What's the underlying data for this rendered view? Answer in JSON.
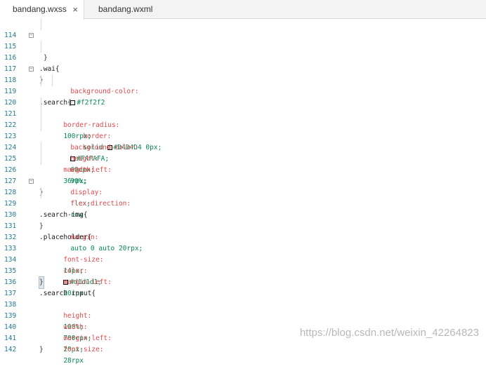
{
  "tabs": [
    {
      "label": "bandang.wxss",
      "active": true,
      "close_icon": "×"
    },
    {
      "label": "bandang.wxml",
      "active": false
    }
  ],
  "watermark": "https://blog.csdn.net/weixin_42264823",
  "colors": {
    "selector": "#1a1a1a",
    "property": "#e0494d",
    "value": "#098658",
    "line_number": "#237893"
  },
  "lines": [
    {
      "n": "114",
      "text": "}"
    },
    {
      "n": "115",
      "text": ".wai{"
    },
    {
      "n": "116",
      "prop": "background-color:",
      "val": "#f2f2f2",
      "swatch": "#f2f2f2"
    },
    {
      "n": "117",
      "text": "}"
    },
    {
      "n": "118",
      "text": ".search{"
    },
    {
      "n": "119",
      "prop": "border:",
      "val": "solid ",
      "swatch": "#D4D4D4",
      "val2": "#D4D4D4 0px;"
    },
    {
      "n": "120",
      "prop": "border-radius:",
      "val": "100rpx;"
    },
    {
      "n": "121",
      "prop": "background-color:",
      "swatch": "#FAFAFA",
      "val": "#FAFAFA;"
    },
    {
      "n": "122",
      "prop": "height:",
      "val": "60rpx;"
    },
    {
      "n": "123",
      "prop": "width:",
      "val": "90%;"
    },
    {
      "n": "124",
      "prop": "margin-left:",
      "val": "36rpx;"
    },
    {
      "n": "125",
      "prop": "display:",
      "val": "flex;"
    },
    {
      "n": "126",
      "prop": "flex-direction:",
      "val": "row"
    },
    {
      "n": "127",
      "text": "}"
    },
    {
      "n": "128",
      "text": ".search-img{"
    },
    {
      "n": "129",
      "prop": "margin:",
      "val": "auto 0 auto 20rpx;"
    },
    {
      "n": "130",
      "text": "}"
    },
    {
      "n": "131",
      "text": ".placeholder{"
    },
    {
      "n": "132",
      "prop": "font-size:",
      "val": "14px;"
    },
    {
      "n": "133",
      "prop": "color:",
      "swatch": "#d1d1d1",
      "val": "#d1d1d1;"
    },
    {
      "n": "134",
      "prop": "margin-left:",
      "val": "20rpx"
    },
    {
      "n": "135",
      "text": "}"
    },
    {
      "n": "136",
      "text": ".search input{"
    },
    {
      "n": "137",
      "prop": "height:",
      "val": "100%;"
    },
    {
      "n": "138",
      "prop": "width:",
      "val": "700rpx;"
    },
    {
      "n": "139",
      "prop": "margin-left:",
      "val": "20px;"
    },
    {
      "n": "140",
      "prop": "font-size:",
      "val": "28rpx"
    },
    {
      "n": "141",
      "text": "}"
    },
    {
      "n": "142",
      "text": ""
    }
  ]
}
